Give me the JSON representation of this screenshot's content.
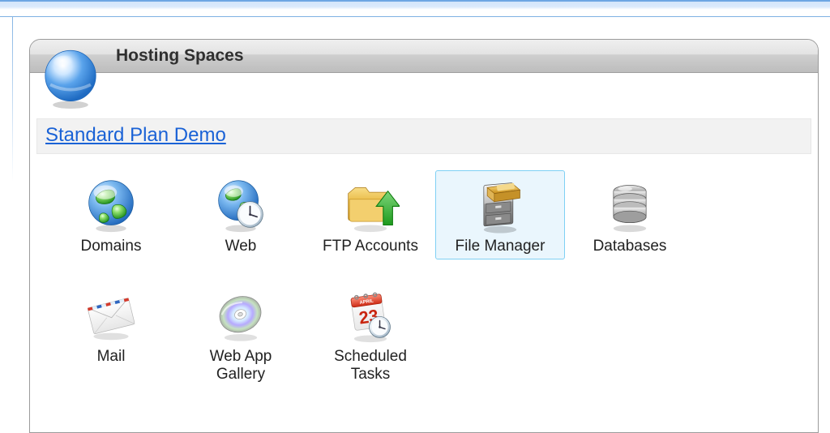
{
  "panel": {
    "title": "Hosting Spaces"
  },
  "plan": {
    "name": "Standard Plan Demo"
  },
  "items": [
    {
      "id": "domains",
      "label": "Domains",
      "icon": "globe-green-icon",
      "selected": false
    },
    {
      "id": "web",
      "label": "Web",
      "icon": "globe-clock-icon",
      "selected": false
    },
    {
      "id": "ftp",
      "label": "FTP Accounts",
      "icon": "folder-upload-icon",
      "selected": false
    },
    {
      "id": "file-manager",
      "label": "File Manager",
      "icon": "file-cabinet-icon",
      "selected": true
    },
    {
      "id": "databases",
      "label": "Databases",
      "icon": "database-icon",
      "selected": false
    },
    {
      "id": "mail",
      "label": "Mail",
      "icon": "envelope-icon",
      "selected": false
    },
    {
      "id": "web-app-gallery",
      "label": "Web App\nGallery",
      "icon": "disc-icon",
      "selected": false
    },
    {
      "id": "scheduled-tasks",
      "label": "Scheduled\nTasks",
      "icon": "calendar-clock-icon",
      "selected": false
    }
  ]
}
